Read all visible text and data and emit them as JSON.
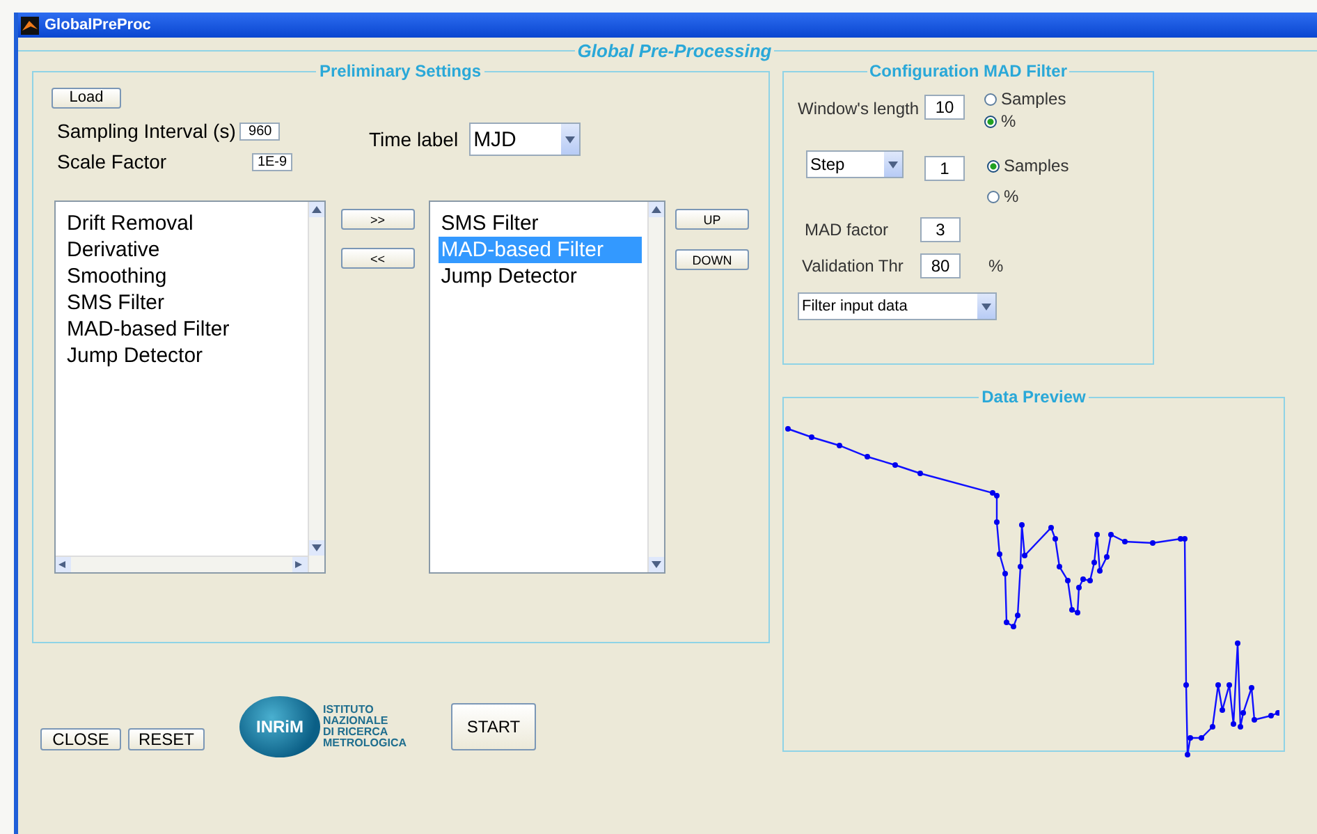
{
  "window": {
    "title": "GlobalPreProc"
  },
  "main_group": {
    "title": "Global Pre-Processing"
  },
  "preliminary": {
    "title": "Preliminary Settings",
    "load_button": "Load",
    "sampling_interval": {
      "label": "Sampling Interval (s)",
      "value": "960"
    },
    "scale_factor": {
      "label": "Scale Factor",
      "value": "1E-9"
    },
    "time_label": {
      "label": "Time label",
      "value": "MJD"
    },
    "available_list": [
      {
        "label": "Drift Removal",
        "selected": false
      },
      {
        "label": "Derivative",
        "selected": false
      },
      {
        "label": "Smoothing",
        "selected": false
      },
      {
        "label": "SMS Filter",
        "selected": false
      },
      {
        "label": "MAD-based Filter",
        "selected": false
      },
      {
        "label": "Jump Detector",
        "selected": false
      }
    ],
    "add_button": ">>",
    "remove_button": "<<",
    "selected_list": [
      {
        "label": "SMS Filter",
        "selected": false
      },
      {
        "label": "MAD-based Filter",
        "selected": true
      },
      {
        "label": "Jump Detector",
        "selected": false
      }
    ],
    "up_button": "UP",
    "down_button": "DOWN"
  },
  "mad_config": {
    "title": "Configuration MAD Filter",
    "window_length": {
      "label": "Window's length",
      "value": "10",
      "units": [
        {
          "label": "Samples",
          "selected": false
        },
        {
          "label": "%",
          "selected": true
        }
      ]
    },
    "step": {
      "mode": "Step",
      "value": "1",
      "units": [
        {
          "label": "Samples",
          "selected": true
        },
        {
          "label": "%",
          "selected": false
        }
      ]
    },
    "mad_factor": {
      "label": "MAD factor",
      "value": "3"
    },
    "validation_thr": {
      "label": "Validation Thr",
      "value": "80",
      "unit": "%"
    },
    "output_select": "Filter input data"
  },
  "data_preview": {
    "title": "Data Preview"
  },
  "logo": {
    "abbr": "INRiM",
    "lines": [
      "ISTITUTO",
      "NAZIONALE",
      "DI RICERCA",
      "METROLOGICA"
    ]
  },
  "buttons": {
    "close": "CLOSE",
    "reset": "RESET",
    "start": "START"
  }
}
